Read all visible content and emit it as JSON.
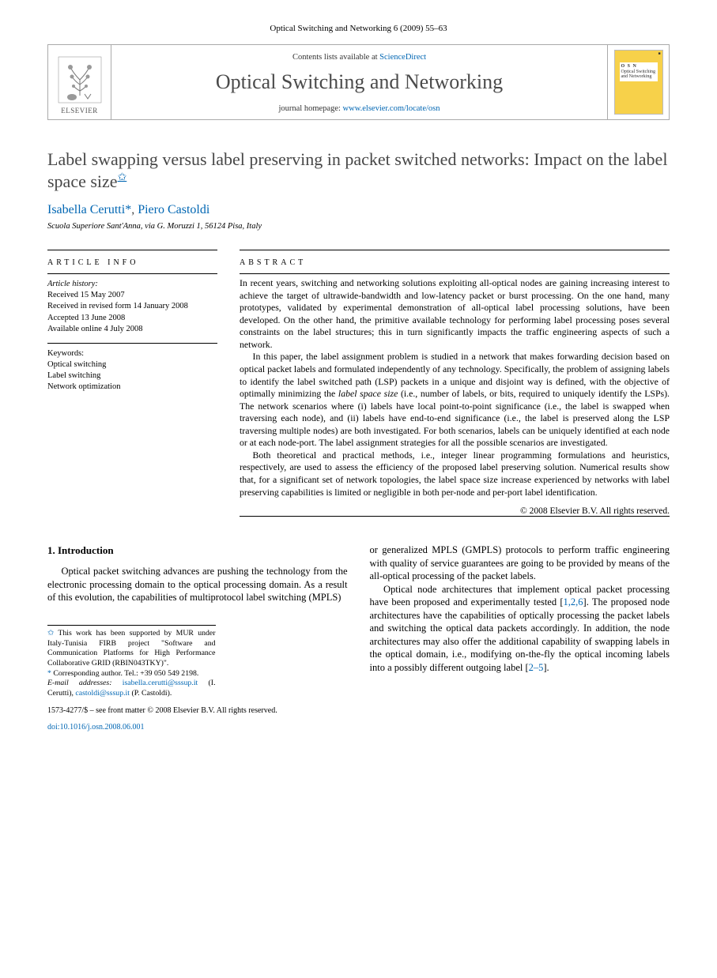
{
  "header_citation": "Optical Switching and Networking 6 (2009) 55–63",
  "masthead": {
    "contents_prefix": "Contents lists available at ",
    "contents_link": "ScienceDirect",
    "journal_name": "Optical Switching and Networking",
    "homepage_prefix": "journal homepage: ",
    "homepage_link": "www.elsevier.com/locate/osn",
    "publisher_label": "ELSEVIER",
    "cover_initials": "O S N",
    "cover_text": "Optical Switching and Networking"
  },
  "title": "Label swapping versus label preserving in packet switched networks: Impact on the label space size",
  "authors_line": "Isabella Cerutti",
  "authors_sep": ", ",
  "author2": "Piero Castoldi",
  "affiliation": "Scuola Superiore Sant'Anna, via G. Moruzzi 1, 56124 Pisa, Italy",
  "info_label": "ARTICLE INFO",
  "abstract_label": "ABSTRACT",
  "history": {
    "heading": "Article history:",
    "received": "Received 15 May 2007",
    "revised": "Received in revised form 14 January 2008",
    "accepted": "Accepted 13 June 2008",
    "online": "Available online 4 July 2008"
  },
  "keywords": {
    "heading": "Keywords:",
    "k1": "Optical switching",
    "k2": "Label switching",
    "k3": "Network optimization"
  },
  "abstract": {
    "p1": "In recent years, switching and networking solutions exploiting all-optical nodes are gaining increasing interest to achieve the target of ultrawide-bandwidth and low-latency packet or burst processing. On the one hand, many prototypes, validated by experimental demonstration of all-optical label processing solutions, have been developed. On the other hand, the primitive available technology for performing label processing poses several constraints on the label structures; this in turn significantly impacts the traffic engineering aspects of such a network.",
    "p2_a": "In this paper, the label assignment problem is studied in a network that makes forwarding decision based on optical packet labels and formulated independently of any technology. Specifically, the problem of assigning labels to identify the label switched path (LSP) packets in a unique and disjoint way is defined, with the objective of optimally minimizing the ",
    "p2_i": "label space size",
    "p2_b": " (i.e., number of labels, or bits, required to uniquely identify the LSPs). The network scenarios where (i) labels have local point-to-point significance (i.e., the label is swapped when traversing each node), and (ii) labels have end-to-end significance (i.e., the label is preserved along the LSP traversing multiple nodes) are both investigated. For both scenarios, labels can be uniquely identified at each node or at each node-port. The label assignment strategies for all the possible scenarios are investigated.",
    "p3": "Both theoretical and practical methods, i.e., integer linear programming formulations and heuristics, respectively, are used to assess the efficiency of the proposed label preserving solution. Numerical results show that, for a significant set of network topologies, the label space size increase experienced by networks with label preserving capabilities is limited or negligible in both per-node and per-port label identification."
  },
  "copyright": "© 2008 Elsevier B.V. All rights reserved.",
  "body": {
    "section_heading": "1. Introduction",
    "left_p1": "Optical packet switching advances are pushing the technology from the electronic processing domain to the optical processing domain. As a result of this evolution, the capabilities of multiprotocol label switching (MPLS)",
    "right_p1": "or generalized MPLS (GMPLS) protocols to perform traffic engineering with quality of service guarantees are going to be provided by means of the all-optical processing of the packet labels.",
    "right_p2_a": "Optical node architectures that implement optical packet processing have been proposed and experimentally tested [",
    "right_p2_refs": "1,2,6",
    "right_p2_b": "]. The proposed node architectures have the capabilities of optically processing the packet labels and switching the optical data packets accordingly. In addition, the node architectures may also offer the additional capability of swapping labels in the optical domain, i.e., modifying on-the-fly the optical incoming labels into a possibly different outgoing label [",
    "right_p2_refs2": "2–5",
    "right_p2_c": "]."
  },
  "footnotes": {
    "fn1": "This work has been supported by MUR under Italy-Tunisia FIRB project \"Software and Communication Platforms for High Performance Collaborative GRID (RBIN043TKY)\".",
    "corr_label": "Corresponding author. Tel.: +39 050 549 2198.",
    "email_label": "E-mail addresses:",
    "email1": "isabella.cerutti@sssup.it",
    "email1_who": " (I. Cerutti), ",
    "email2": "castoldi@sssup.it",
    "email2_who": " (P. Castoldi)."
  },
  "footer": {
    "issn_line": "1573-4277/$ – see front matter © 2008 Elsevier B.V. All rights reserved.",
    "doi_prefix": "doi:",
    "doi": "10.1016/j.osn.2008.06.001"
  }
}
